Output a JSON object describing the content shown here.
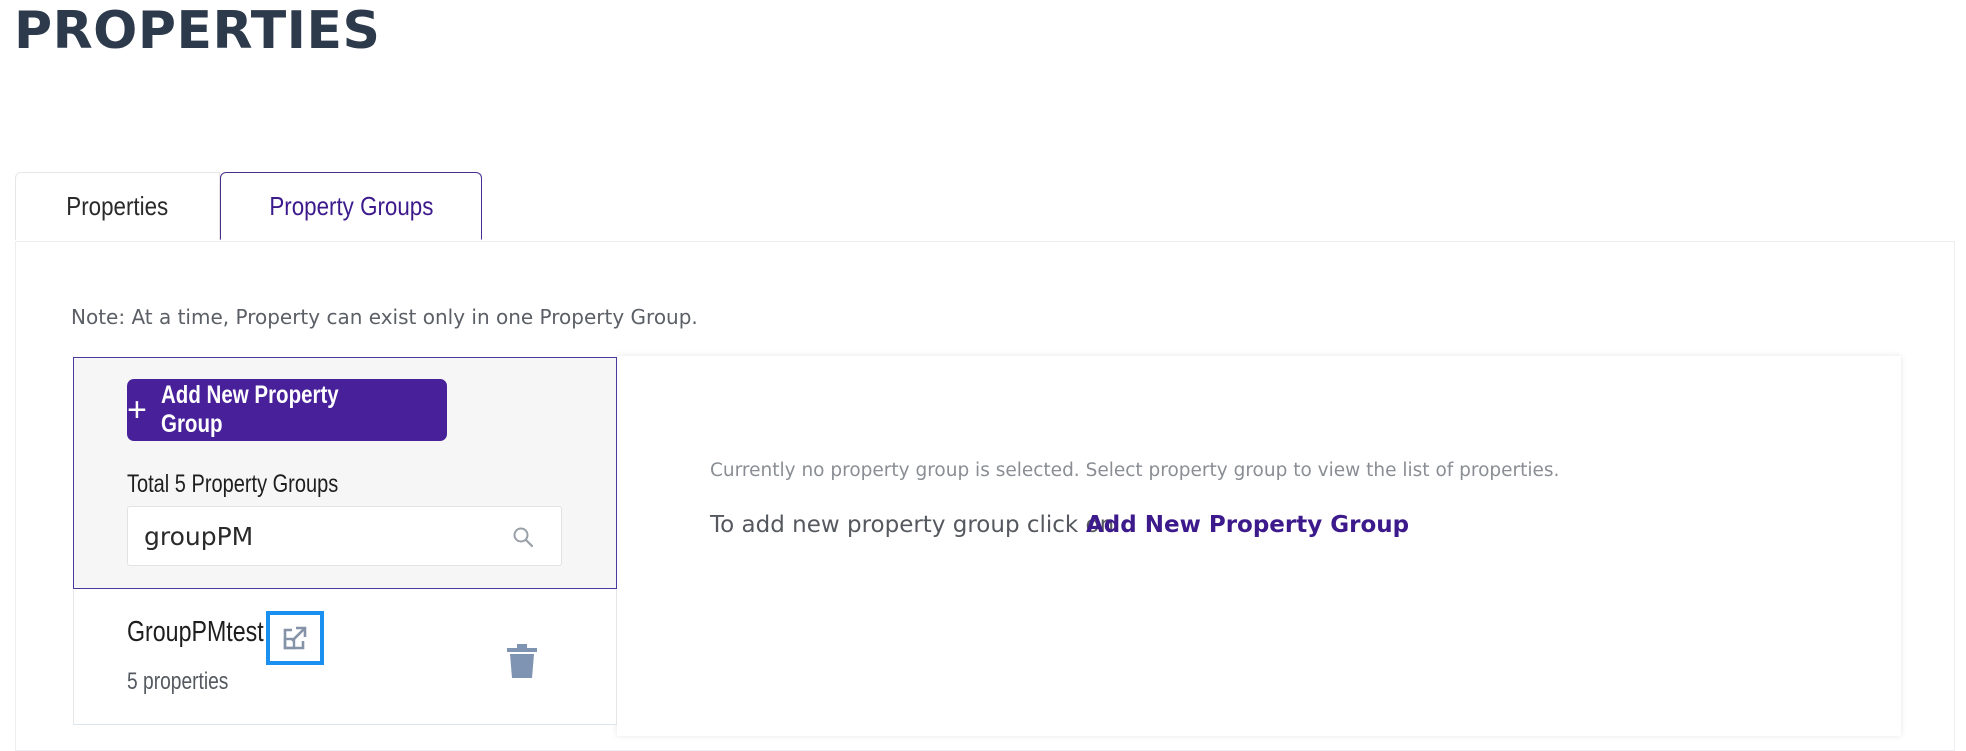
{
  "page": {
    "title": "PROPERTIES"
  },
  "tabs": [
    {
      "label": "Properties",
      "active": false
    },
    {
      "label": "Property Groups",
      "active": true
    }
  ],
  "note": "Note: At a time, Property can exist only in one Property Group.",
  "sidebar": {
    "add_button_icon": "plus-icon",
    "add_button_label": "Add New Property Group",
    "total_label": "Total 5 Property Groups",
    "search": {
      "value": "groupPM",
      "icon": "search-icon"
    },
    "groups": [
      {
        "name": "GroupPMtest",
        "count": "5 properties",
        "open_icon": "open-external-icon",
        "delete_icon": "trash-icon"
      }
    ]
  },
  "detail": {
    "empty_message": "Currently no property group is selected. Select property group to view the list of properties.",
    "add_hint": "To add new property group click on",
    "add_hint_link": "Add New Property Group"
  },
  "colors": {
    "title": "#2c3a4b",
    "accent": "#47209a",
    "link": "#3d1a8c",
    "focus_outline": "#1a90f0",
    "trash": "#7f93b3"
  }
}
